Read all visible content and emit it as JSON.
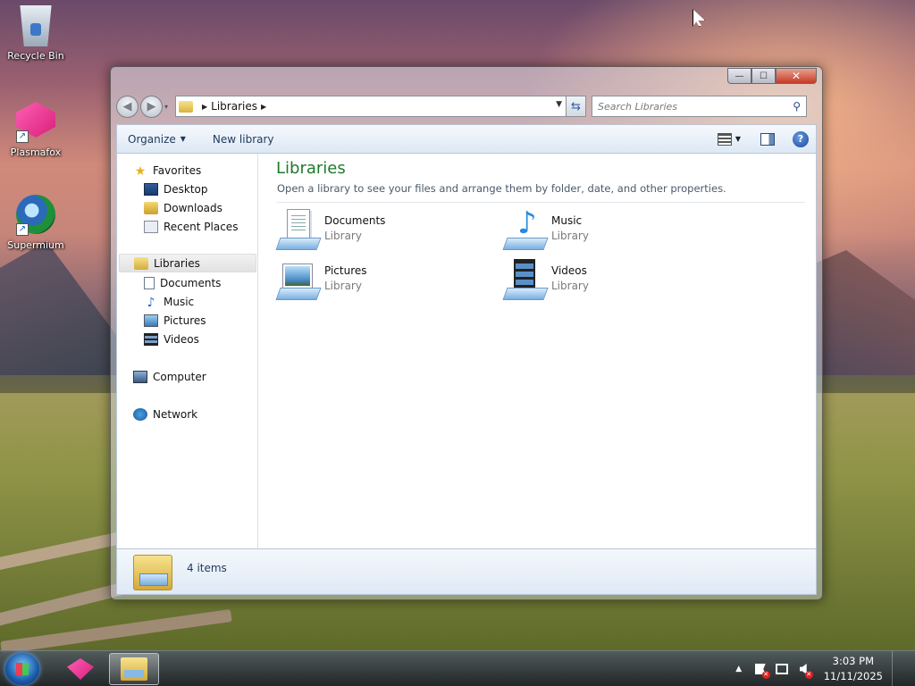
{
  "desktop": {
    "icons": [
      {
        "label": "Recycle Bin",
        "icon": "recycle-bin-icon"
      },
      {
        "label": "Plasmafox",
        "icon": "plasmafox-icon"
      },
      {
        "label": "Supermium",
        "icon": "supermium-icon"
      }
    ]
  },
  "window": {
    "controls": {
      "minimize": "—",
      "maximize": "☐",
      "close": "✕"
    },
    "nav": {
      "back_icon": "◀",
      "forward_icon": "▶",
      "address": {
        "crumb": "Libraries"
      },
      "search_placeholder": "Search Libraries"
    },
    "toolbar": {
      "organize_label": "Organize",
      "new_library_label": "New library"
    },
    "navpane": {
      "favorites": {
        "label": "Favorites",
        "items": [
          {
            "label": "Desktop"
          },
          {
            "label": "Downloads"
          },
          {
            "label": "Recent Places"
          }
        ]
      },
      "libraries": {
        "label": "Libraries",
        "items": [
          {
            "label": "Documents"
          },
          {
            "label": "Music"
          },
          {
            "label": "Pictures"
          },
          {
            "label": "Videos"
          }
        ]
      },
      "computer_label": "Computer",
      "network_label": "Network"
    },
    "main": {
      "title": "Libraries",
      "subtitle": "Open a library to see your files and arrange them by folder, date, and other properties.",
      "libraries": [
        {
          "name": "Documents",
          "type": "Library"
        },
        {
          "name": "Music",
          "type": "Library"
        },
        {
          "name": "Pictures",
          "type": "Library"
        },
        {
          "name": "Videos",
          "type": "Library"
        }
      ]
    },
    "status": {
      "count": "4 items"
    },
    "colors": {
      "title_green": "#1e7a2a",
      "link_blue": "#1e395b"
    }
  },
  "taskbar": {
    "clock": {
      "time": "3:03 PM",
      "date": "11/11/2025"
    }
  }
}
